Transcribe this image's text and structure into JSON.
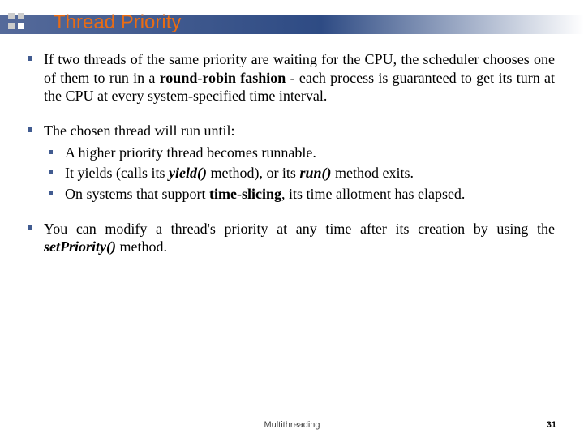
{
  "title": "Thread Priority",
  "bullets": [
    {
      "pre": "If two threads of the same priority are waiting for the CPU, the scheduler chooses one of them to run in a ",
      "bold1": "round-robin fashion",
      "post": " - each process is guaranteed to get its turn at the CPU at every system-specified time interval."
    },
    {
      "text": "The chosen thread will run until:",
      "subs": [
        {
          "text": "A higher priority thread becomes runnable."
        },
        {
          "pre": "It yields (calls its ",
          "em1": "yield()",
          "mid": " method), or its ",
          "em2": "run()",
          "post": " method exits."
        },
        {
          "pre": "On systems that support ",
          "bold1": "time-slicing",
          "post": ", its time allotment has elapsed."
        }
      ]
    },
    {
      "pre": "You can modify a thread's priority at any time after its creation by using the ",
      "em1": "setPriority()",
      "post": " method."
    }
  ],
  "footer": "Multithreading",
  "page": "31"
}
